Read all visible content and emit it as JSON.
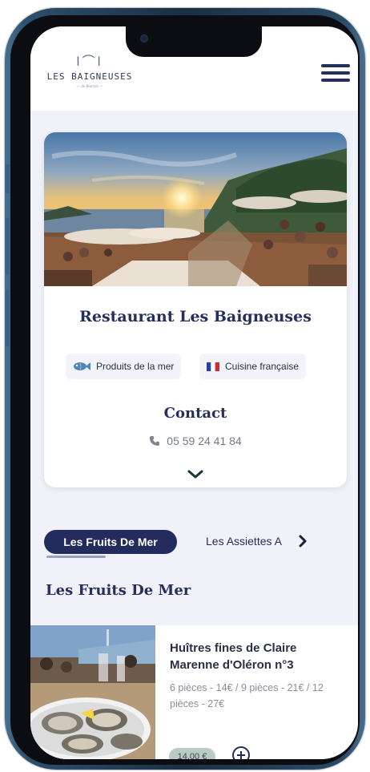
{
  "header": {
    "logo_cutlery": "ǀ⌒ǀ",
    "logo_name": "LES BAIGNEUSES",
    "logo_sub": "— de Biarritz —"
  },
  "restaurant": {
    "title": "Restaurant Les Baigneuses",
    "tags": [
      {
        "label": "Produits de la mer",
        "icon": "fish-icon"
      },
      {
        "label": "Cuisine française",
        "icon": "french-flag-icon"
      }
    ],
    "contact_title": "Contact",
    "phone": "05 59 24 41 84"
  },
  "tabs": {
    "active": "Les Fruits De Mer",
    "next": "Les Assiettes A"
  },
  "section": {
    "title": "Les Fruits De Mer"
  },
  "menu_items": [
    {
      "name": "Huîtres fines de Claire Marenne d'Oléron n°3",
      "description": "6 pièces - 14€ / 9 pièces - 21€ / 12 pièces - 27€",
      "price": "14,00 €"
    }
  ],
  "colors": {
    "navy": "#232c5c",
    "background": "#f1f2f9",
    "price_badge": "#b8cbc4"
  }
}
